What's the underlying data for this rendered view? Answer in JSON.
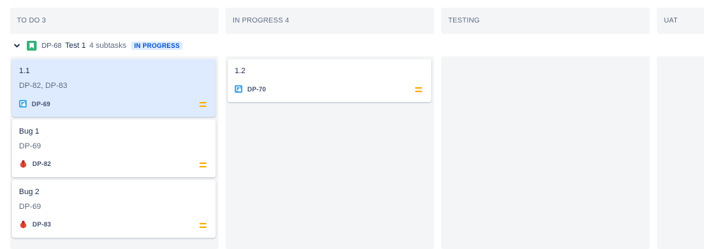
{
  "columns": [
    {
      "label": "TO DO 3"
    },
    {
      "label": "IN PROGRESS 4"
    },
    {
      "label": "TESTING"
    },
    {
      "label": "UAT"
    }
  ],
  "swimlane": {
    "key": "DP-68",
    "title": "Test 1",
    "subtasks": "4 subtasks",
    "status": "IN PROGRESS",
    "story_icon": "story-icon",
    "chevron_icon": "chevron-down-icon"
  },
  "cards": [
    {
      "title": "1.1",
      "links": "DP-82, DP-83",
      "key": "DP-69",
      "type_icon": "subtask-icon",
      "priority_icon": "priority-medium-icon",
      "selected": true
    },
    {
      "title": "Bug 1",
      "links": "DP-69",
      "key": "DP-82",
      "type_icon": "bug-icon",
      "priority_icon": "priority-medium-icon"
    },
    {
      "title": "Bug 2",
      "links": "DP-69",
      "key": "DP-83",
      "type_icon": "bug-icon",
      "priority_icon": "priority-medium-icon"
    },
    {
      "title": "1.2",
      "key": "DP-70",
      "type_icon": "subtask-icon",
      "priority_icon": "priority-medium-icon"
    }
  ],
  "colors": {
    "column_bg": "#f4f5f7",
    "selected_card": "#deebff",
    "status_lozenge_text": "#0052cc",
    "story_green": "#36b37e",
    "priority_medium": "#ffab00",
    "subtask_blue": "#4bade8",
    "bug_red": "#e5493a"
  }
}
